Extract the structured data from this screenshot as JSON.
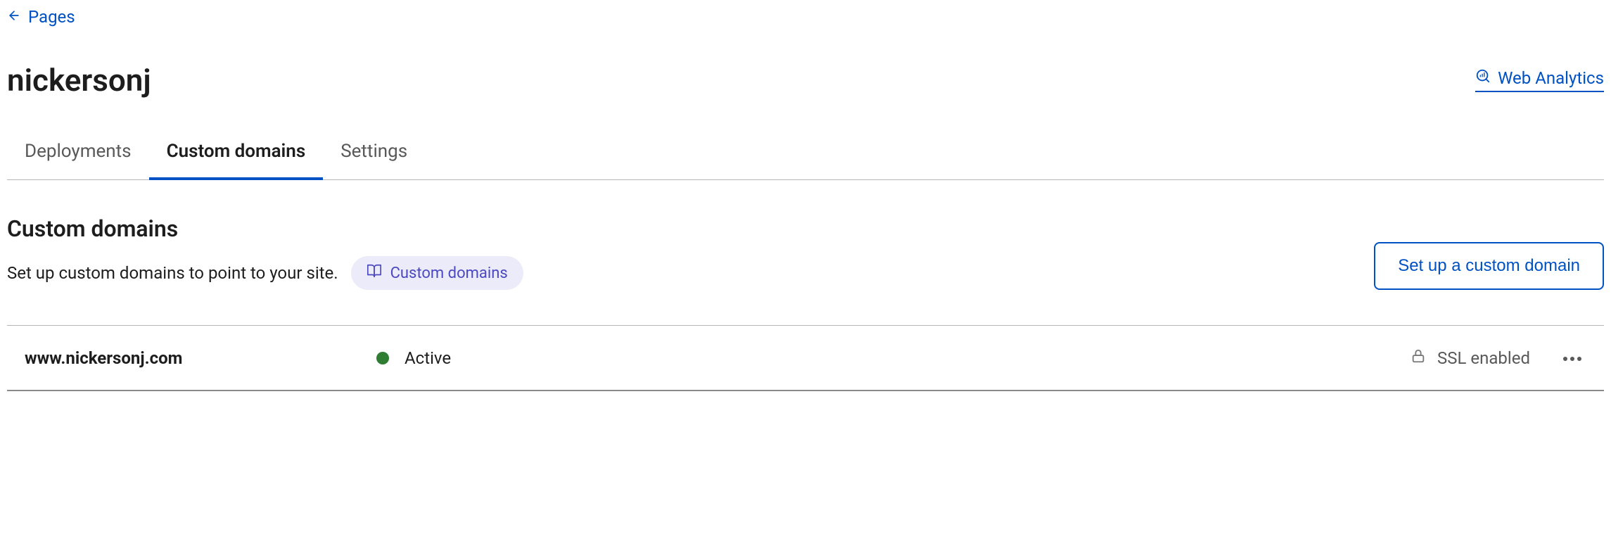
{
  "breadcrumb": {
    "label": "Pages"
  },
  "header": {
    "title": "nickersonj",
    "analytics_label": "Web Analytics"
  },
  "tabs": [
    {
      "label": "Deployments",
      "active": false
    },
    {
      "label": "Custom domains",
      "active": true
    },
    {
      "label": "Settings",
      "active": false
    }
  ],
  "section": {
    "title": "Custom domains",
    "description": "Set up custom domains to point to your site.",
    "help_pill": "Custom domains",
    "setup_button": "Set up a custom domain"
  },
  "domains": [
    {
      "name": "www.nickersonj.com",
      "status": "Active",
      "status_color": "#2e7d32",
      "ssl": "SSL enabled"
    }
  ]
}
